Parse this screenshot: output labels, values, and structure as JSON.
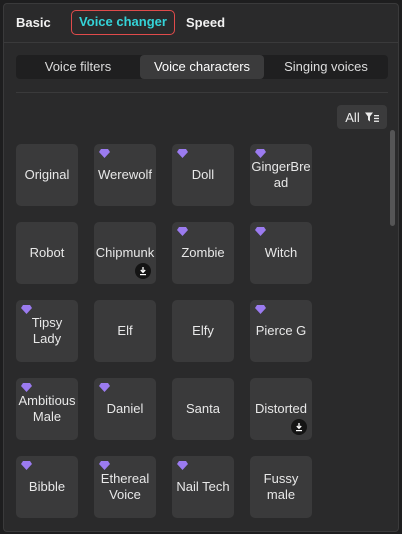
{
  "tabs": {
    "basic": "Basic",
    "voice_changer": "Voice changer",
    "speed": "Speed"
  },
  "segments": [
    "Voice filters",
    "Voice characters",
    "Singing voices"
  ],
  "active_segment": "Voice characters",
  "filter_label": "All",
  "colors": {
    "accent": "#34d3d8",
    "highlight_border": "#e04b4b",
    "premium_gem": "#9b7bf0"
  },
  "voices": [
    {
      "name": "Original",
      "premium": false,
      "download": false
    },
    {
      "name": "Werewolf",
      "premium": true,
      "download": false
    },
    {
      "name": "Doll",
      "premium": true,
      "download": false
    },
    {
      "name": "GingerBre ad",
      "premium": true,
      "download": false
    },
    {
      "name": "Robot",
      "premium": false,
      "download": false
    },
    {
      "name": "Chipmunk",
      "premium": false,
      "download": true
    },
    {
      "name": "Zombie",
      "premium": true,
      "download": false
    },
    {
      "name": "Witch",
      "premium": true,
      "download": false
    },
    {
      "name": "Tipsy Lady",
      "premium": true,
      "download": false
    },
    {
      "name": "Elf",
      "premium": false,
      "download": false
    },
    {
      "name": "Elfy",
      "premium": false,
      "download": false
    },
    {
      "name": "Pierce G",
      "premium": true,
      "download": false
    },
    {
      "name": "Ambitious Male",
      "premium": true,
      "download": false
    },
    {
      "name": "Daniel",
      "premium": true,
      "download": false
    },
    {
      "name": "Santa",
      "premium": false,
      "download": false
    },
    {
      "name": "Distorted",
      "premium": false,
      "download": true
    },
    {
      "name": "Bibble",
      "premium": true,
      "download": false
    },
    {
      "name": "Ethereal Voice",
      "premium": true,
      "download": false
    },
    {
      "name": "Nail Tech",
      "premium": true,
      "download": false
    },
    {
      "name": "Fussy male",
      "premium": false,
      "download": false
    }
  ]
}
